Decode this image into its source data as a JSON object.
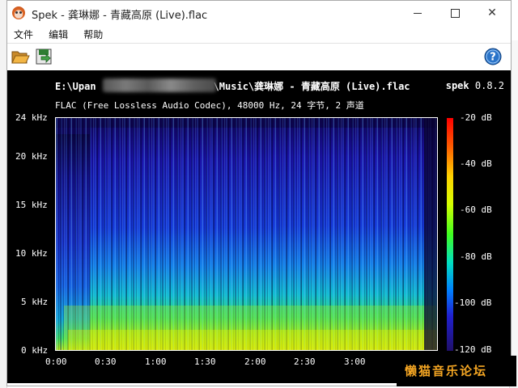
{
  "window": {
    "title": "Spek - 龚琳娜 - 青藏高原 (Live).flac"
  },
  "menu": [
    "文件",
    "编辑",
    "帮助"
  ],
  "toolbar": {
    "open_icon": "folder-open-icon",
    "save_icon": "save-export-icon",
    "help_icon": "help-icon"
  },
  "spectrogram": {
    "path_prefix": "E:\\Upan",
    "path_suffix": "\\Music\\龚琳娜 - 青藏高原 (Live).flac",
    "app_name": "spek",
    "version": "0.8.2",
    "info": "FLAC (Free Lossless Audio Codec), 48000 Hz, 24 字节, 2 声道",
    "y_ticks": [
      "24 kHz",
      "20 kHz",
      "15 kHz",
      "10 kHz",
      "5 kHz",
      "0 kHz"
    ],
    "x_ticks": [
      "0:00",
      "0:30",
      "1:00",
      "1:30",
      "2:00",
      "2:30",
      "3:00"
    ],
    "db_ticks": [
      "-20 dB",
      "-40 dB",
      "-60 dB",
      "-80 dB",
      "-100 dB",
      "-120 dB"
    ]
  },
  "watermark": "懒猫音乐论坛",
  "colors": {
    "background": "#000000",
    "watermark": "#f5a623"
  }
}
